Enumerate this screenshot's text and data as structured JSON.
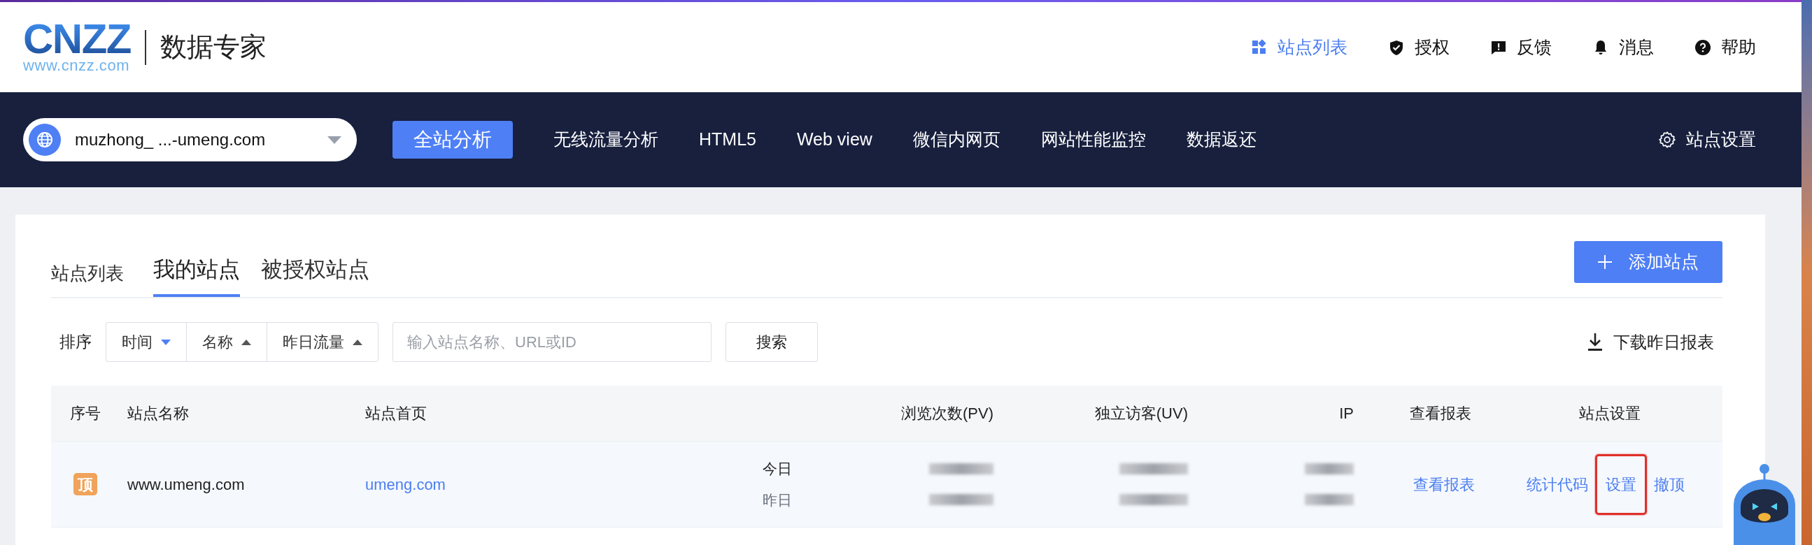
{
  "header": {
    "logo": {
      "wordmark": "CNZZ",
      "url": "www.cnzz.com"
    },
    "product": "数据专家",
    "top_links": [
      {
        "label": "站点列表",
        "kind": "apps",
        "selected": true
      },
      {
        "label": "授权",
        "kind": "shield",
        "selected": false
      },
      {
        "label": "反馈",
        "kind": "feedback",
        "selected": false
      },
      {
        "label": "消息",
        "kind": "bell",
        "selected": false
      },
      {
        "label": "帮助",
        "kind": "help",
        "selected": false
      }
    ]
  },
  "nav": {
    "site_selector": {
      "value": "muzhong_ ...-umeng.com"
    },
    "items": [
      {
        "label": "全站分析",
        "selected": true
      },
      {
        "label": "无线流量分析",
        "selected": false
      },
      {
        "label": "HTML5",
        "selected": false
      },
      {
        "label": "Web view",
        "selected": false
      },
      {
        "label": "微信内网页",
        "selected": false
      },
      {
        "label": "网站性能监控",
        "selected": false
      },
      {
        "label": "数据返还",
        "selected": false
      }
    ],
    "settings": "站点设置"
  },
  "card": {
    "title": "站点列表",
    "tabs": [
      {
        "label": "我的站点",
        "selected": true
      },
      {
        "label": "被授权站点",
        "selected": false
      }
    ],
    "add_button": "添加站点",
    "sort_label": "排序",
    "sort_options": [
      {
        "label": "时间",
        "kind": "down",
        "selected": true
      },
      {
        "label": "名称",
        "kind": "up",
        "selected": false
      },
      {
        "label": "昨日流量",
        "kind": "up",
        "selected": false
      }
    ],
    "search": {
      "placeholder": "输入站点名称、URL或ID"
    },
    "search_button": "搜索",
    "download": "下载昨日报表",
    "table": {
      "columns": [
        "序号",
        "站点名称",
        "站点首页",
        "",
        "浏览次数(PV)",
        "独立访客(UV)",
        "IP",
        "查看报表",
        "站点设置"
      ],
      "rows": [
        {
          "pinned": true,
          "pin_label": "顶",
          "name": "www.umeng.com",
          "homepage": "umeng.com",
          "periods": [
            "今日",
            "昨日"
          ],
          "report_link": "查看报表",
          "actions": [
            {
              "label": "统计代码",
              "highlighted": false
            },
            {
              "label": "设置",
              "highlighted": true
            },
            {
              "label": "撤顶",
              "highlighted": false
            }
          ]
        }
      ]
    }
  }
}
